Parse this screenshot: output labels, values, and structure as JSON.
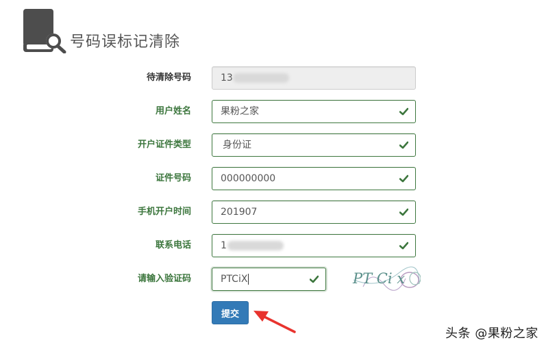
{
  "page_title": "号码误标记清除",
  "form": {
    "fields": [
      {
        "label": "待清除号码",
        "value": "13",
        "readonly": true
      },
      {
        "label": "用户姓名",
        "value": "果粉之家"
      },
      {
        "label": "开户证件类型",
        "value": "身份证"
      },
      {
        "label": "证件号码",
        "value": "000000000"
      },
      {
        "label": "手机开户时间",
        "value": "201907"
      },
      {
        "label": "联系电话",
        "value": "1"
      },
      {
        "label": "请输入验证码",
        "value": "PTCiX"
      }
    ],
    "captcha_image_text": "PT Ci x",
    "submit_label": "提交"
  },
  "watermark": "头条 @果粉之家",
  "colors": {
    "success": "#3c763d",
    "primary": "#337ab7",
    "arrow": "#e8332e"
  }
}
